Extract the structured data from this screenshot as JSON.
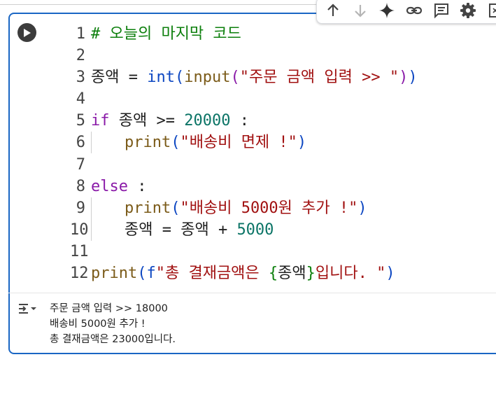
{
  "toolbar": {
    "buttons": [
      {
        "name": "move-up-icon"
      },
      {
        "name": "move-down-icon"
      },
      {
        "name": "gemini-sparkle-icon"
      },
      {
        "name": "link-icon"
      },
      {
        "name": "comment-icon"
      },
      {
        "name": "settings-icon"
      },
      {
        "name": "open-in-tab-icon"
      }
    ]
  },
  "code": {
    "lines": [
      {
        "n": "1",
        "parts": [
          {
            "c": "c-comment",
            "t": "# 오늘의 마지막 코드"
          }
        ]
      },
      {
        "n": "2",
        "parts": []
      },
      {
        "n": "3",
        "parts": [
          {
            "c": "c-op",
            "t": "종액 = "
          },
          {
            "c": "c-blue",
            "t": "int"
          },
          {
            "c": "c-paren1",
            "t": "("
          },
          {
            "c": "c-builtin",
            "t": "input"
          },
          {
            "c": "c-paren2",
            "t": "("
          },
          {
            "c": "c-str",
            "t": "\"주문 금액 입력 >> \""
          },
          {
            "c": "c-paren2",
            "t": ")"
          },
          {
            "c": "c-paren1",
            "t": ")"
          }
        ]
      },
      {
        "n": "4",
        "parts": []
      },
      {
        "n": "5",
        "parts": [
          {
            "c": "c-kw",
            "t": "if"
          },
          {
            "c": "c-op",
            "t": " 종액 >= "
          },
          {
            "c": "c-num",
            "t": "20000"
          },
          {
            "c": "c-op",
            "t": " :"
          }
        ]
      },
      {
        "n": "6",
        "indent": true,
        "parts": [
          {
            "c": "c-builtin",
            "t": "print"
          },
          {
            "c": "c-paren1",
            "t": "("
          },
          {
            "c": "c-str",
            "t": "\"배송비 면제 !\""
          },
          {
            "c": "c-paren1",
            "t": ")"
          }
        ]
      },
      {
        "n": "7",
        "parts": []
      },
      {
        "n": "8",
        "parts": [
          {
            "c": "c-kw",
            "t": "else"
          },
          {
            "c": "c-op",
            "t": " :"
          }
        ]
      },
      {
        "n": "9",
        "indent": true,
        "parts": [
          {
            "c": "c-builtin",
            "t": "print"
          },
          {
            "c": "c-paren1",
            "t": "("
          },
          {
            "c": "c-str",
            "t": "\"배송비 5000원 추가 !\""
          },
          {
            "c": "c-paren1",
            "t": ")"
          }
        ]
      },
      {
        "n": "10",
        "indent": true,
        "parts": [
          {
            "c": "c-op",
            "t": "종액 = 종액 + "
          },
          {
            "c": "c-num",
            "t": "5000"
          }
        ]
      },
      {
        "n": "11",
        "parts": []
      },
      {
        "n": "12",
        "parts": [
          {
            "c": "c-builtin",
            "t": "print"
          },
          {
            "c": "c-paren1",
            "t": "("
          },
          {
            "c": "c-blue",
            "t": "f"
          },
          {
            "c": "c-str",
            "t": "\"총 결재금액은 "
          },
          {
            "c": "c-brace",
            "t": "{"
          },
          {
            "c": "c-op",
            "t": "종액"
          },
          {
            "c": "c-brace",
            "t": "}"
          },
          {
            "c": "c-str",
            "t": "입니다. \""
          },
          {
            "c": "c-paren1",
            "t": ")"
          }
        ]
      }
    ]
  },
  "output": {
    "lines": [
      "주문 금액 입력 >> 18000",
      "배송비 5000원 추가 !",
      "총 결재금액은 23000입니다."
    ]
  }
}
